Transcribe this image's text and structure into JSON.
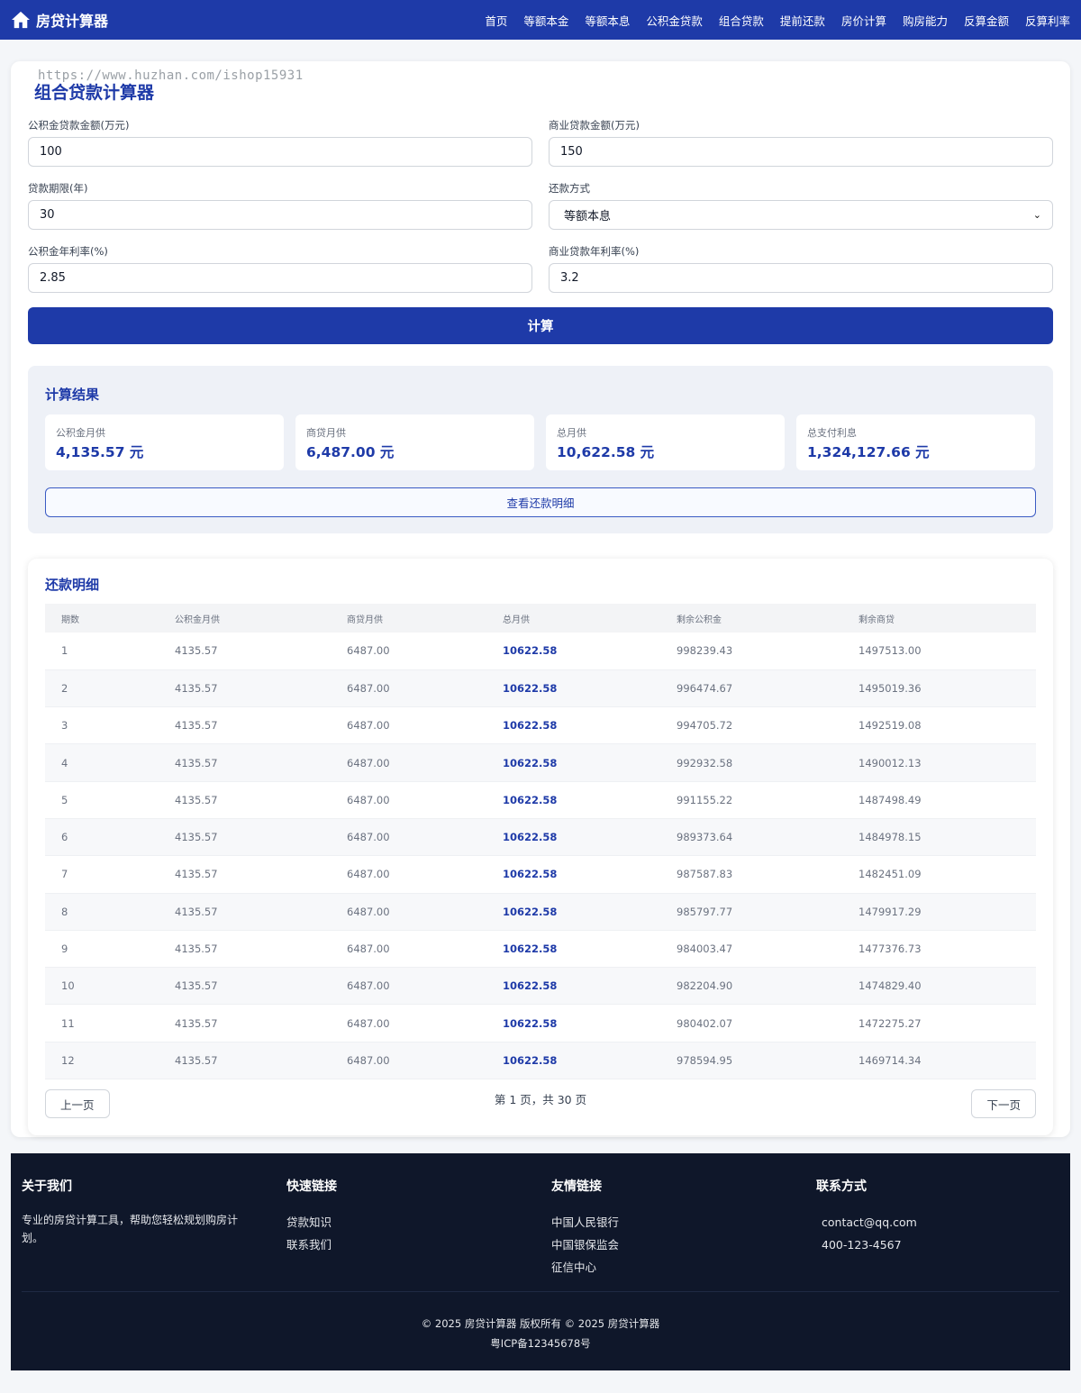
{
  "navbar": {
    "brand": "房贷计算器",
    "links": [
      "首页",
      "等额本金",
      "等额本息",
      "公积金贷款",
      "组合贷款",
      "提前还款",
      "房价计算",
      "购房能力",
      "反算金额",
      "反算利率"
    ]
  },
  "watermark": "https://www.huzhan.com/ishop15931",
  "form": {
    "title": "组合贷款计算器",
    "fund_amount_label": "公积金贷款金额(万元)",
    "fund_amount_value": "100",
    "commercial_amount_label": "商业贷款金额(万元)",
    "commercial_amount_value": "150",
    "term_label": "贷款期限(年)",
    "term_value": "30",
    "method_label": "还款方式",
    "method_value": "等额本息",
    "fund_rate_label": "公积金年利率(%)",
    "fund_rate_value": "2.85",
    "commercial_rate_label": "商业贷款年利率(%)",
    "commercial_rate_value": "3.2",
    "calc_button": "计算"
  },
  "results": {
    "title": "计算结果",
    "stats": [
      {
        "label": "公积金月供",
        "value": "4,135.57 元"
      },
      {
        "label": "商贷月供",
        "value": "6,487.00 元"
      },
      {
        "label": "总月供",
        "value": "10,622.58 元"
      },
      {
        "label": "总支付利息",
        "value": "1,324,127.66 元"
      }
    ],
    "detail_button": "查看还款明细"
  },
  "schedule": {
    "title": "还款明细",
    "columns": [
      "期数",
      "公积金月供",
      "商贷月供",
      "总月供",
      "剩余公积金",
      "剩余商贷"
    ],
    "rows": [
      [
        "1",
        "4135.57",
        "6487.00",
        "10622.58",
        "998239.43",
        "1497513.00"
      ],
      [
        "2",
        "4135.57",
        "6487.00",
        "10622.58",
        "996474.67",
        "1495019.36"
      ],
      [
        "3",
        "4135.57",
        "6487.00",
        "10622.58",
        "994705.72",
        "1492519.08"
      ],
      [
        "4",
        "4135.57",
        "6487.00",
        "10622.58",
        "992932.58",
        "1490012.13"
      ],
      [
        "5",
        "4135.57",
        "6487.00",
        "10622.58",
        "991155.22",
        "1487498.49"
      ],
      [
        "6",
        "4135.57",
        "6487.00",
        "10622.58",
        "989373.64",
        "1484978.15"
      ],
      [
        "7",
        "4135.57",
        "6487.00",
        "10622.58",
        "987587.83",
        "1482451.09"
      ],
      [
        "8",
        "4135.57",
        "6487.00",
        "10622.58",
        "985797.77",
        "1479917.29"
      ],
      [
        "9",
        "4135.57",
        "6487.00",
        "10622.58",
        "984003.47",
        "1477376.73"
      ],
      [
        "10",
        "4135.57",
        "6487.00",
        "10622.58",
        "982204.90",
        "1474829.40"
      ],
      [
        "11",
        "4135.57",
        "6487.00",
        "10622.58",
        "980402.07",
        "1472275.27"
      ],
      [
        "12",
        "4135.57",
        "6487.00",
        "10622.58",
        "978594.95",
        "1469714.34"
      ]
    ],
    "prev_button": "上一页",
    "next_button": "下一页",
    "page_info": "第 1 页，共 30 页"
  },
  "footer": {
    "about_title": "关于我们",
    "about_text": "专业的房贷计算工具，帮助您轻松规划购房计划。",
    "quick_title": "快速链接",
    "quick_links": [
      "贷款知识",
      "联系我们"
    ],
    "friend_title": "友情链接",
    "friend_links": [
      "中国人民银行",
      "中国银保监会",
      "征信中心"
    ],
    "contact_title": "联系方式",
    "contact_email": "contact@qq.com",
    "contact_phone": "400-123-4567",
    "copyright": "© 2025 房贷计算器 版权所有 © 2025 房贷计算器",
    "icp": "粤ICP备12345678号"
  },
  "colors": {
    "primary": "#1e3aa8",
    "footer_bg": "#0f172a",
    "page_bg": "#f4f6f9"
  },
  "icons": {
    "brand": "home-icon",
    "select": "chevron-down-icon"
  }
}
